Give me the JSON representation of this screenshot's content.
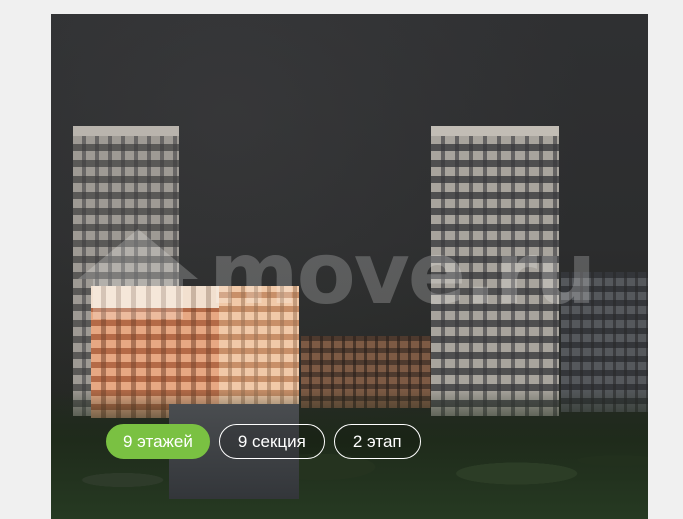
{
  "watermark": {
    "text": "move.ru",
    "icon": "house-icon"
  },
  "tags": [
    {
      "label": "9 этажей",
      "active": true
    },
    {
      "label": "9 секция",
      "active": false
    },
    {
      "label": "2 этап",
      "active": false
    }
  ],
  "colors": {
    "accent": "#7ac142",
    "page_background": "#f0f0f0",
    "tag_text": "#ffffff"
  }
}
